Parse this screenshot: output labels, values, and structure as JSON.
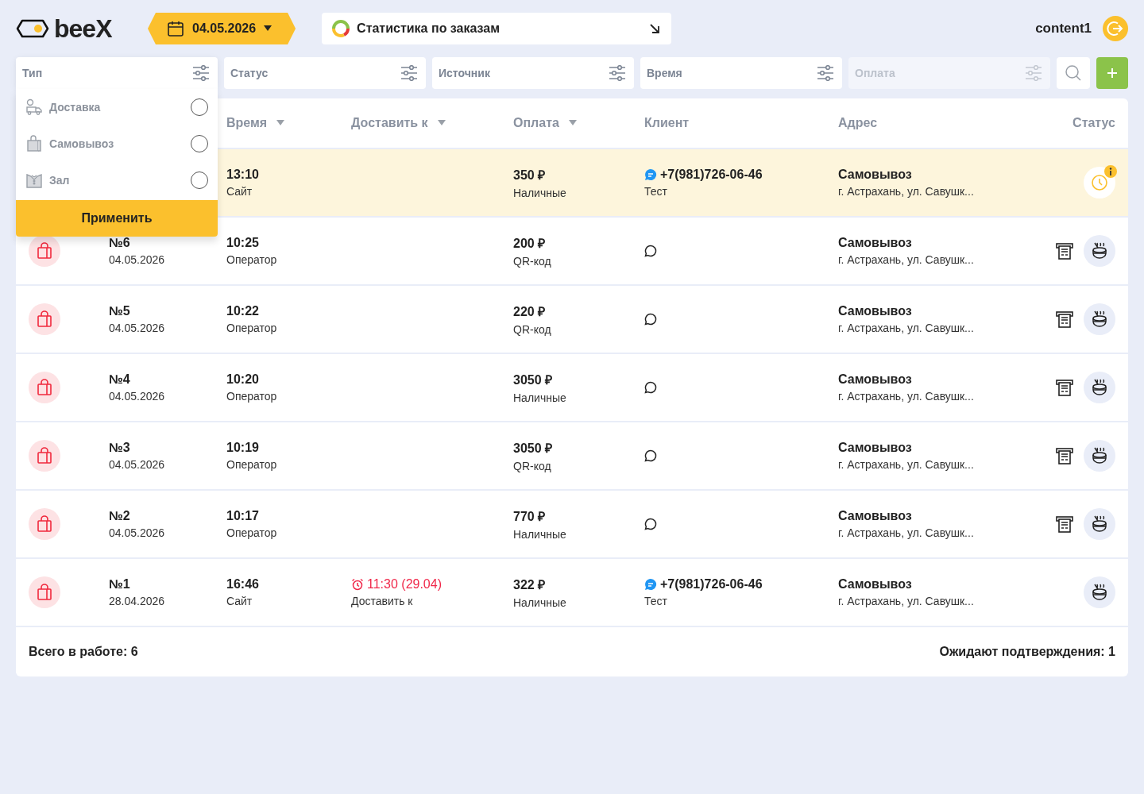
{
  "header": {
    "logo": "beeX",
    "date": "04.05.2026",
    "stats_label": "Статистика по заказам",
    "user": "content1"
  },
  "filters": [
    {
      "label": "Тип",
      "disabled": false,
      "open": true
    },
    {
      "label": "Статус",
      "disabled": false,
      "open": false
    },
    {
      "label": "Источник",
      "disabled": false,
      "open": false
    },
    {
      "label": "Время",
      "disabled": false,
      "open": false
    },
    {
      "label": "Оплата",
      "disabled": true,
      "open": false
    }
  ],
  "type_dropdown": {
    "options": [
      {
        "kind": "delivery",
        "label": "Доставка",
        "selected": false
      },
      {
        "kind": "pickup",
        "label": "Самовывоз",
        "selected": false
      },
      {
        "kind": "hall",
        "label": "Зал",
        "selected": false
      }
    ],
    "apply_button": "Применить"
  },
  "table": {
    "columns": [
      {
        "label": "Время",
        "sortable": true
      },
      {
        "label": "Доставить к",
        "sortable": true
      },
      {
        "label": "Оплата",
        "sortable": true
      },
      {
        "label": "Клиент",
        "sortable": false
      },
      {
        "label": "Адрес",
        "sortable": false
      },
      {
        "label": "Статус",
        "sortable": false
      }
    ],
    "rows": [
      {
        "highlighted": true,
        "time": "13:10",
        "source": "Сайт",
        "amount": "350 ₽",
        "payment": "Наличные",
        "client": {
          "kind": "phone",
          "phone": "+7(981)726-06-46",
          "name": "Тест"
        },
        "address_title": "Самовывоз",
        "address": "г. Астрахань, ул. Савушк...",
        "status_icons": [
          {
            "kind": "clock"
          }
        ]
      },
      {
        "highlighted": false,
        "order_type": {
          "kind": "bag"
        },
        "number": "№6",
        "date": "04.05.2026",
        "time": "10:25",
        "source": "Оператор",
        "amount": "200 ₽",
        "payment": "QR-код",
        "client": {
          "kind": "chat"
        },
        "address_title": "Самовывоз",
        "address": "г. Астрахань, ул. Савушк...",
        "status_icons": [
          {
            "kind": "receipt"
          },
          {
            "kind": "pot"
          }
        ]
      },
      {
        "highlighted": false,
        "order_type": {
          "kind": "bag"
        },
        "number": "№5",
        "date": "04.05.2026",
        "time": "10:22",
        "source": "Оператор",
        "amount": "220 ₽",
        "payment": "QR-код",
        "client": {
          "kind": "chat"
        },
        "address_title": "Самовывоз",
        "address": "г. Астрахань, ул. Савушк...",
        "status_icons": [
          {
            "kind": "receipt"
          },
          {
            "kind": "pot"
          }
        ]
      },
      {
        "highlighted": false,
        "order_type": {
          "kind": "bag"
        },
        "number": "№4",
        "date": "04.05.2026",
        "time": "10:20",
        "source": "Оператор",
        "amount": "3050 ₽",
        "payment": "Наличные",
        "client": {
          "kind": "chat"
        },
        "address_title": "Самовывоз",
        "address": "г. Астрахань, ул. Савушк...",
        "status_icons": [
          {
            "kind": "receipt"
          },
          {
            "kind": "pot"
          }
        ]
      },
      {
        "highlighted": false,
        "order_type": {
          "kind": "bag"
        },
        "number": "№3",
        "date": "04.05.2026",
        "time": "10:19",
        "source": "Оператор",
        "amount": "3050 ₽",
        "payment": "QR-код",
        "client": {
          "kind": "chat"
        },
        "address_title": "Самовывоз",
        "address": "г. Астрахань, ул. Савушк...",
        "status_icons": [
          {
            "kind": "receipt"
          },
          {
            "kind": "pot"
          }
        ]
      },
      {
        "highlighted": false,
        "order_type": {
          "kind": "bag"
        },
        "number": "№2",
        "date": "04.05.2026",
        "time": "10:17",
        "source": "Оператор",
        "amount": "770 ₽",
        "payment": "Наличные",
        "client": {
          "kind": "chat"
        },
        "address_title": "Самовывоз",
        "address": "г. Астрахань, ул. Савушк...",
        "status_icons": [
          {
            "kind": "receipt"
          },
          {
            "kind": "pot"
          }
        ]
      },
      {
        "highlighted": false,
        "order_type": {
          "kind": "bag"
        },
        "number": "№1",
        "date": "28.04.2026",
        "time": "16:46",
        "source": "Сайт",
        "deliver_time": "11:30 (29.04)",
        "deliver_label": "Доставить к",
        "amount": "322 ₽",
        "payment": "Наличные",
        "client": {
          "kind": "phone",
          "phone": "+7(981)726-06-46",
          "name": "Тест"
        },
        "address_title": "Самовывоз",
        "address": "г. Астрахань, ул. Савушк...",
        "status_icons": [
          {
            "kind": "pot"
          }
        ]
      }
    ]
  },
  "footer": {
    "total": "Всего в работе: 6",
    "pending": "Ожидают подтверждения: 1"
  }
}
